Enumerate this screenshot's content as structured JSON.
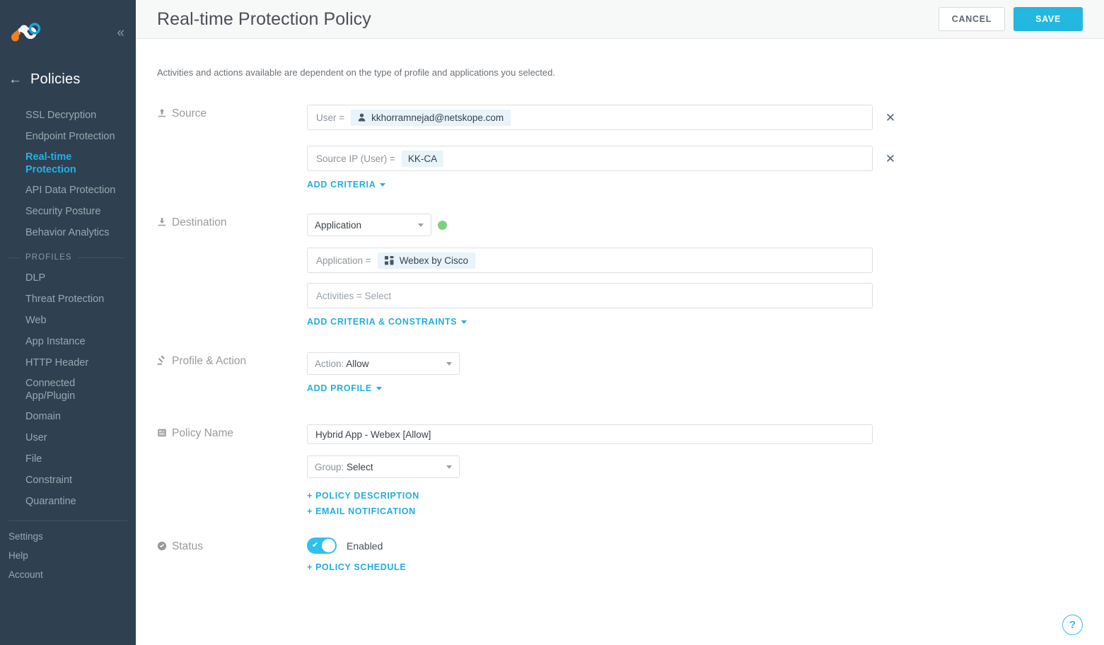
{
  "sidebar": {
    "logo_name": "netskope-logo",
    "collapse_icon": "«",
    "back_arrow": "←",
    "nav_title": "Policies",
    "items": [
      {
        "label": "SSL Decryption",
        "active": false
      },
      {
        "label": "Endpoint Protection",
        "active": false
      },
      {
        "label": "Real-time Protection",
        "active": true
      },
      {
        "label": "API Data Protection",
        "active": false
      },
      {
        "label": "Security Posture",
        "active": false
      },
      {
        "label": "Behavior Analytics",
        "active": false
      }
    ],
    "profiles_header": "PROFILES",
    "profiles": [
      {
        "label": "DLP"
      },
      {
        "label": "Threat Protection"
      },
      {
        "label": "Web"
      },
      {
        "label": "App Instance"
      },
      {
        "label": "HTTP Header"
      },
      {
        "label": "Connected App/Plugin"
      },
      {
        "label": "Domain"
      },
      {
        "label": "User"
      },
      {
        "label": "File"
      },
      {
        "label": "Constraint"
      },
      {
        "label": "Quarantine"
      }
    ],
    "footer": [
      {
        "label": "Settings"
      },
      {
        "label": "Help"
      },
      {
        "label": "Account"
      }
    ]
  },
  "header": {
    "title": "Real-time Protection Policy",
    "cancel_label": "CANCEL",
    "save_label": "SAVE"
  },
  "main": {
    "helper_text": "Activities and actions available are dependent on the type of profile and applications you selected.",
    "source": {
      "label": "Source",
      "icon": "upload-icon",
      "criteria": [
        {
          "key": "User =",
          "chip_icon": "person-icon",
          "chip_value": "kkhorramnejad@netskope.com",
          "remove_icon": "✕"
        },
        {
          "key": "Source IP (User) =",
          "chip_icon": "",
          "chip_value": "KK-CA",
          "remove_icon": "✕"
        }
      ],
      "add_criteria_label": "ADD CRITERIA"
    },
    "destination": {
      "label": "Destination",
      "icon": "download-icon",
      "type_select_value": "Application",
      "status_dot_color": "#7ed07e",
      "criteria": [
        {
          "key": "Application =",
          "chip_icon": "apps-grid-icon",
          "chip_value": "Webex by Cisco"
        }
      ],
      "activities_placeholder": "Activities = Select",
      "add_criteria_label": "ADD CRITERIA & CONSTRAINTS"
    },
    "profile_action": {
      "label": "Profile & Action",
      "icon": "gavel-icon",
      "action_prefix": "Action:",
      "action_value": "Allow",
      "add_profile_label": "ADD PROFILE"
    },
    "policy_name": {
      "label": "Policy Name",
      "icon": "list-icon",
      "name_value": "Hybrid App - Webex [Allow]",
      "group_prefix": "Group:",
      "group_value": "Select",
      "policy_description_label": "+ POLICY DESCRIPTION",
      "email_notification_label": "+ EMAIL NOTIFICATION"
    },
    "status": {
      "label": "Status",
      "icon": "check-circle-icon",
      "toggle_state": "Enabled",
      "toggle_on": true,
      "policy_schedule_label": "+ POLICY SCHEDULE"
    },
    "help_fab_label": "?"
  },
  "colors": {
    "accent": "#22b8e0",
    "sidebar_bg": "#2f4050",
    "active_nav": "#21b2e6",
    "status_green": "#7ed07e"
  }
}
